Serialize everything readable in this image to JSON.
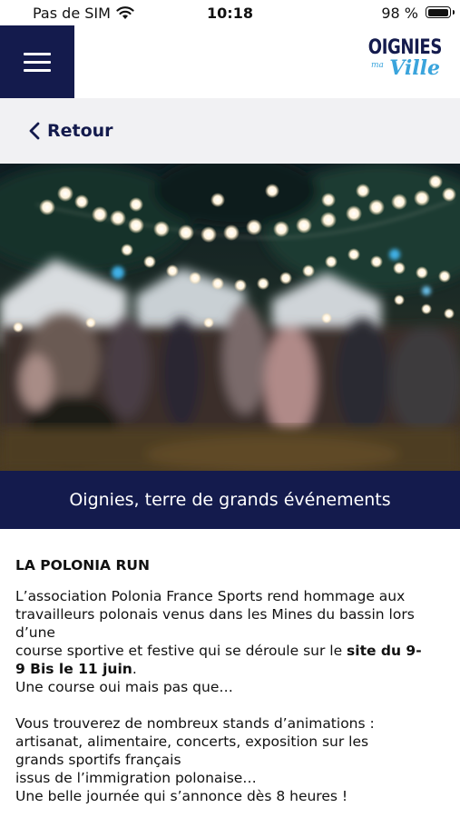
{
  "status_bar": {
    "carrier": "Pas de SIM",
    "time": "10:18",
    "battery": "98 %"
  },
  "header": {
    "logo_top": "OIGNIES",
    "logo_ma": "ma",
    "logo_ville": "Ville",
    "brand_navy": "#141b4d",
    "brand_blue": "#3aa4dc"
  },
  "nav": {
    "back_label": "Retour"
  },
  "banner": {
    "text": "Oignies, terre de grands événements"
  },
  "article": {
    "title": "LA POLONIA RUN",
    "p1_lines": [
      "L’association Polonia France Sports rend hommage aux",
      "travailleurs polonais venus dans les Mines du bassin lors",
      "d’une"
    ],
    "p1_line4_pre": "course sportive et festive qui se déroule sur le ",
    "p1_line4_bold": "site du 9-",
    "p1_line5_bold": "9 Bis le 11 juin",
    "p1_line5_post": ".",
    "p1_line6": "Une course oui mais pas que…",
    "p2_lines": [
      "Vous trouverez de nombreux stands d’animations :",
      "artisanat, alimentaire, concerts, exposition sur les",
      "grands sportifs français",
      "issus de l’immigration polonaise…",
      "Une belle journée qui s’annonce dès 8 heures !"
    ]
  }
}
